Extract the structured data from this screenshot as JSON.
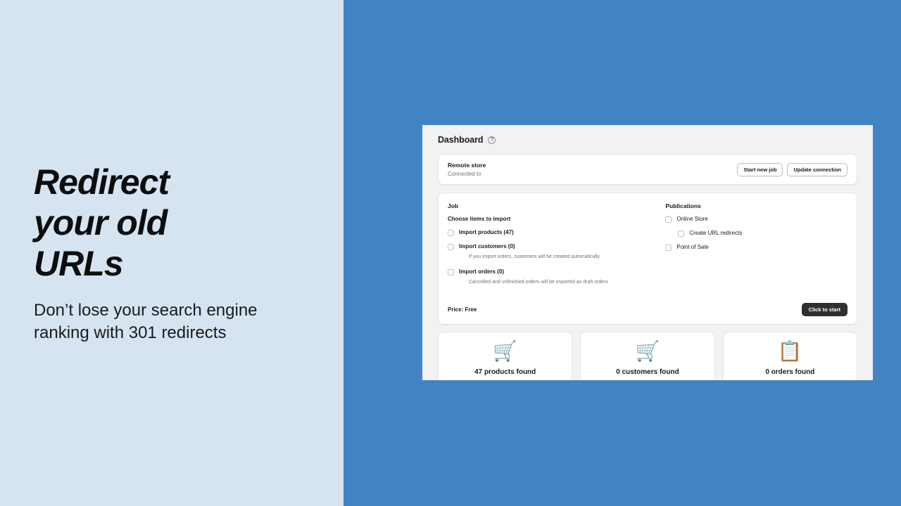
{
  "promo": {
    "headline": "Redirect your old URLs",
    "subtext": "Don’t lose your search engine ranking with 301 redirects",
    "bg_color": "#d6e4f2",
    "page_bg_color": "#4284c3"
  },
  "app": {
    "page_title": "Dashboard",
    "help_icon": "question-circle-icon",
    "remote_store": {
      "title": "Remote store",
      "subtitle": "Connected to",
      "buttons": [
        {
          "label": "Start new job"
        },
        {
          "label": "Update connection"
        }
      ]
    },
    "job": {
      "heading": "Job",
      "subheading": "Choose items to import",
      "items": [
        {
          "label": "Import products (47)",
          "checked": false,
          "helper": ""
        },
        {
          "label": "Import customers (0)",
          "checked": false,
          "helper": "If you import orders, customers will be created automatically"
        },
        {
          "label": "Import orders (0)",
          "checked": false,
          "helper": "Cancelled and unfinished orders will be imported as draft orders"
        }
      ]
    },
    "publications": {
      "heading": "Publications",
      "items": [
        {
          "label": "Online Store",
          "checked": false,
          "indent": false
        },
        {
          "label": "Create URL redirects",
          "checked": false,
          "indent": true
        },
        {
          "label": "Point of Sale",
          "checked": false,
          "indent": false
        }
      ]
    },
    "footer": {
      "price_label": "Price: Free",
      "start_button": "Click to start",
      "start_button_color": "#303030"
    },
    "stats": [
      {
        "icon": "shopping-cart-boxes-icon",
        "glyph": "🛒",
        "label": "47 products found"
      },
      {
        "icon": "shopping-person-icon",
        "glyph": "🛒",
        "label": "0 customers found"
      },
      {
        "icon": "boxes-clipboard-icon",
        "glyph": "📋",
        "label": "0 orders found"
      }
    ]
  }
}
